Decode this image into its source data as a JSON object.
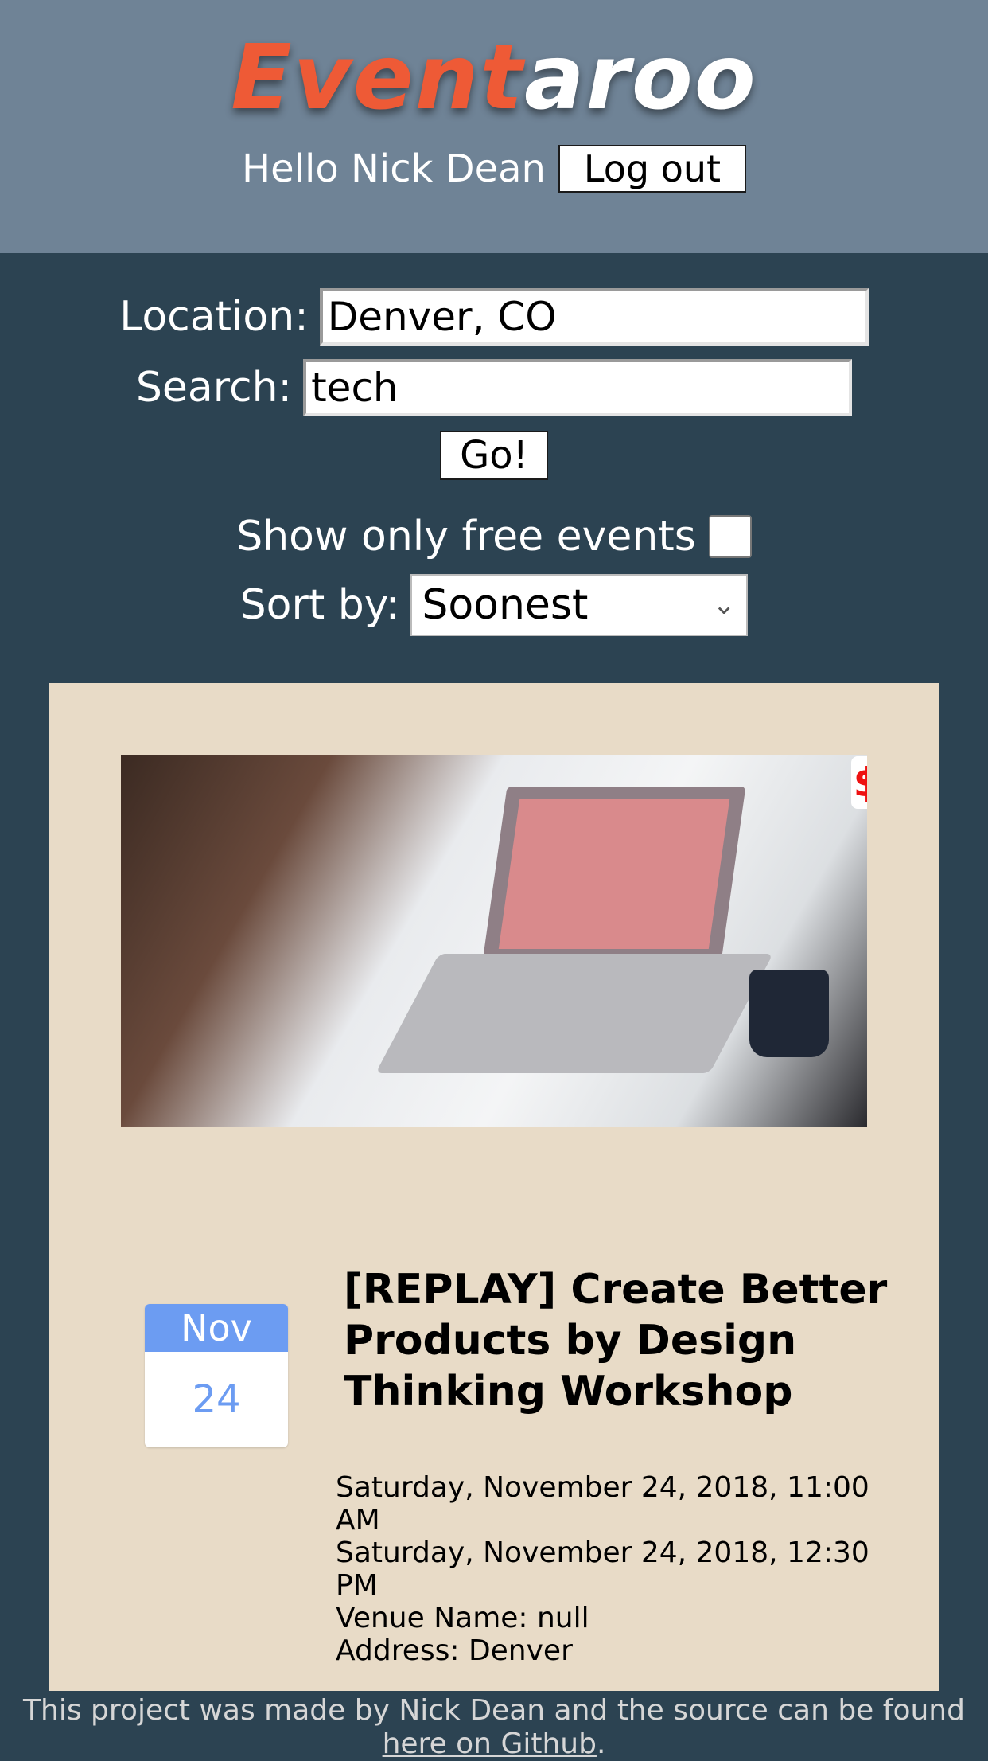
{
  "header": {
    "logo_red": "Event",
    "logo_white": "aroo",
    "greeting": "Hello Nick Dean",
    "logout_label": "Log out"
  },
  "search": {
    "location_label": "Location:",
    "location_value": "Denver, CO",
    "search_label": "Search:",
    "search_value": "tech",
    "go_label": "Go!",
    "free_label": "Show only free events",
    "free_checked": false,
    "sort_label": "Sort by:",
    "sort_value": "Soonest"
  },
  "events": [
    {
      "price_symbol": "$",
      "month": "Nov",
      "day": "24",
      "title": "[REPLAY] Create Better Products by Design Thinking Workshop",
      "start": "Saturday, November 24, 2018, 11:00 AM",
      "end": "Saturday, November 24, 2018, 12:30 PM",
      "venue": "Venue Name: null",
      "address": "Address: Denver"
    }
  ],
  "footer": {
    "text": "This project was made by Nick Dean and the source can be found",
    "link_text": "here on Github",
    "trailing": "."
  },
  "colors": {
    "header_bg": "#6f8396",
    "page_bg": "#2c4352",
    "card_bg": "#e8dbc7",
    "logo_accent": "#ee5a36",
    "date_blue": "#6c9cf2",
    "price_red": "#ee1111"
  }
}
